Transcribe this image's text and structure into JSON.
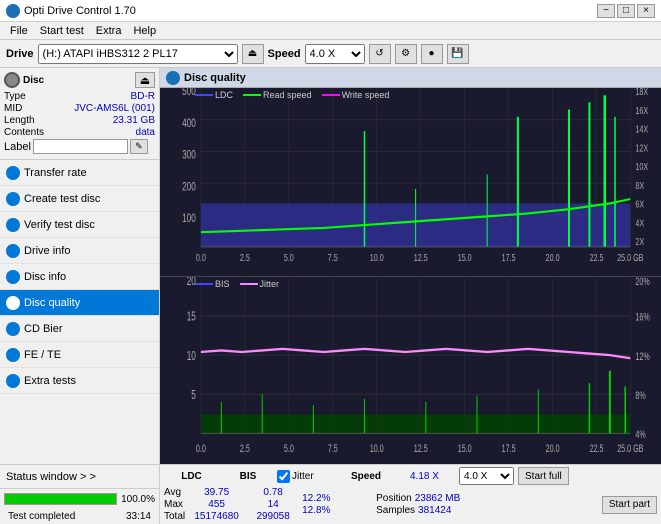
{
  "titlebar": {
    "title": "Opti Drive Control 1.70",
    "minimize": "−",
    "maximize": "□",
    "close": "×"
  },
  "menubar": {
    "items": [
      "File",
      "Start test",
      "Extra",
      "Help"
    ]
  },
  "drivebar": {
    "label": "Drive",
    "drive_value": "(H:) ATAPI iHBS312  2 PL17",
    "speed_label": "Speed",
    "speed_value": "4.0 X"
  },
  "disc": {
    "type_label": "Type",
    "type_value": "BD-R",
    "mid_label": "MID",
    "mid_value": "JVC-AMS6L (001)",
    "length_label": "Length",
    "length_value": "23.31 GB",
    "contents_label": "Contents",
    "contents_value": "data",
    "label_label": "Label",
    "label_value": ""
  },
  "nav_items": [
    {
      "id": "transfer-rate",
      "label": "Transfer rate",
      "active": false
    },
    {
      "id": "create-test-disc",
      "label": "Create test disc",
      "active": false
    },
    {
      "id": "verify-test-disc",
      "label": "Verify test disc",
      "active": false
    },
    {
      "id": "drive-info",
      "label": "Drive info",
      "active": false
    },
    {
      "id": "disc-info",
      "label": "Disc info",
      "active": false
    },
    {
      "id": "disc-quality",
      "label": "Disc quality",
      "active": true
    },
    {
      "id": "cd-bier",
      "label": "CD Bier",
      "active": false
    },
    {
      "id": "fe-te",
      "label": "FE / TE",
      "active": false
    },
    {
      "id": "extra-tests",
      "label": "Extra tests",
      "active": false
    }
  ],
  "status_window": {
    "label": "Status window > >"
  },
  "progress": {
    "value": 100,
    "text": "100.0%"
  },
  "status_text": "Test completed",
  "time_text": "33:14",
  "disc_quality": {
    "title": "Disc quality",
    "legend_top": [
      "LDC",
      "Read speed",
      "Write speed"
    ],
    "legend_bottom": [
      "BIS",
      "Jitter"
    ],
    "chart1": {
      "y_max": 500,
      "y_right_labels": [
        "18X",
        "16X",
        "14X",
        "12X",
        "10X",
        "8X",
        "6X",
        "4X",
        "2X"
      ],
      "x_labels": [
        "0.0",
        "2.5",
        "5.0",
        "7.5",
        "10.0",
        "12.5",
        "15.0",
        "17.5",
        "20.0",
        "22.5",
        "25.0 GB"
      ]
    },
    "chart2": {
      "y_max": 20,
      "y_right_labels": [
        "20%",
        "16%",
        "12%",
        "8%",
        "4%"
      ],
      "x_labels": [
        "0.0",
        "2.5",
        "5.0",
        "7.5",
        "10.0",
        "12.5",
        "15.0",
        "17.5",
        "20.0",
        "22.5",
        "25.0 GB"
      ]
    }
  },
  "stats": {
    "col_headers": [
      "LDC",
      "BIS",
      "",
      "Jitter",
      "Speed",
      ""
    ],
    "avg_label": "Avg",
    "avg_ldc": "39.75",
    "avg_bis": "0.78",
    "avg_jitter": "12.2%",
    "avg_speed": "4.18 X",
    "max_label": "Max",
    "max_ldc": "455",
    "max_bis": "14",
    "max_jitter": "12.8%",
    "total_label": "Total",
    "total_ldc": "15174680",
    "total_bis": "299058",
    "position_label": "Position",
    "position_value": "23862 MB",
    "samples_label": "Samples",
    "samples_value": "381424",
    "start_full": "Start full",
    "start_part": "Start part",
    "speed_select": "4.0 X",
    "jitter_checkbox": true
  }
}
